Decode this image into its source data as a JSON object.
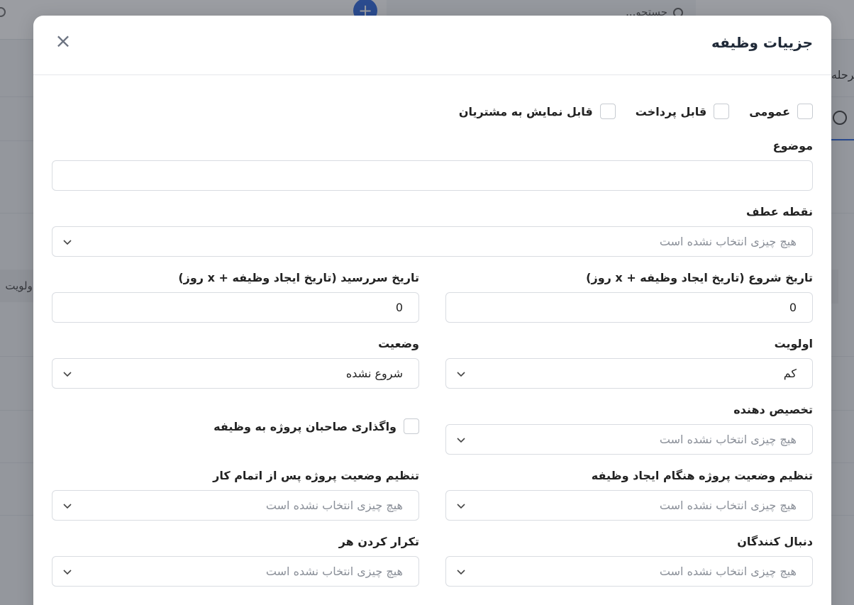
{
  "background": {
    "search_text": "جستجو...",
    "plus_label": "+",
    "right_tab_text": "مرحله",
    "left_pill_text": "اولویت"
  },
  "modal": {
    "title": "جزییات وظیفه",
    "close_label": "×",
    "checkboxes": {
      "public": "عمومی",
      "billable": "قابل پرداخت",
      "visible_to_customers": "قابل نمایش به مشتریان"
    },
    "subject": {
      "label": "موضوع",
      "value": ""
    },
    "milestone": {
      "label": "نقطه عطف",
      "placeholder": "هیچ چیزی انتخاب نشده است"
    },
    "start_date": {
      "label": "تاریخ شروع (تاریخ ایجاد وظیفه + x روز)",
      "value": "0"
    },
    "due_date": {
      "label": "تاریخ سررسید (تاریخ ایجاد وظیفه + x روز)",
      "value": "0"
    },
    "priority": {
      "label": "اولویت",
      "value": "کم"
    },
    "status": {
      "label": "وضعیت",
      "value": "شروع نشده"
    },
    "assignees": {
      "label": "تخصیص دهنده",
      "placeholder": "هیچ چیزی انتخاب نشده است"
    },
    "assign_project_owners": {
      "label": "واگذاری صاحبان پروژه به وظیفه"
    },
    "project_status_on_create": {
      "label": "تنظیم وضعیت پروژه هنگام ایجاد وظیفه",
      "placeholder": "هیچ چیزی انتخاب نشده است"
    },
    "project_status_on_complete": {
      "label": "تنظیم وضعیت پروژه پس از اتمام کار",
      "placeholder": "هیچ چیزی انتخاب نشده است"
    },
    "followers": {
      "label": "دنبال کنندگان",
      "placeholder": "هیچ چیزی انتخاب نشده است"
    },
    "repeat_every": {
      "label": "تکرار کردن هر",
      "placeholder": "هیچ چیزی انتخاب نشده است"
    }
  }
}
